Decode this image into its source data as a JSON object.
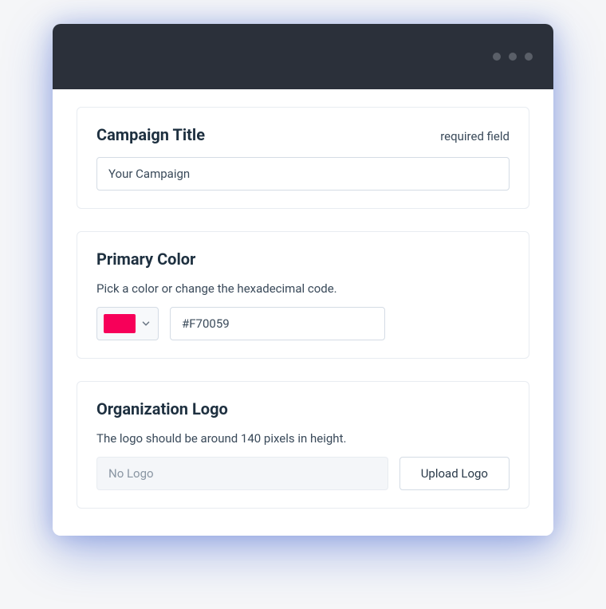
{
  "campaign": {
    "title_label": "Campaign Title",
    "required_text": "required field",
    "title_value": "Your Campaign"
  },
  "color": {
    "title_label": "Primary Color",
    "help_text": "Pick a color or change the hexadecimal code.",
    "swatch_hex": "#f70059",
    "hex_value": "#F70059"
  },
  "logo": {
    "title_label": "Organization Logo",
    "help_text": "The logo should be around 140 pixels in height.",
    "empty_text": "No Logo",
    "upload_label": "Upload Logo"
  }
}
